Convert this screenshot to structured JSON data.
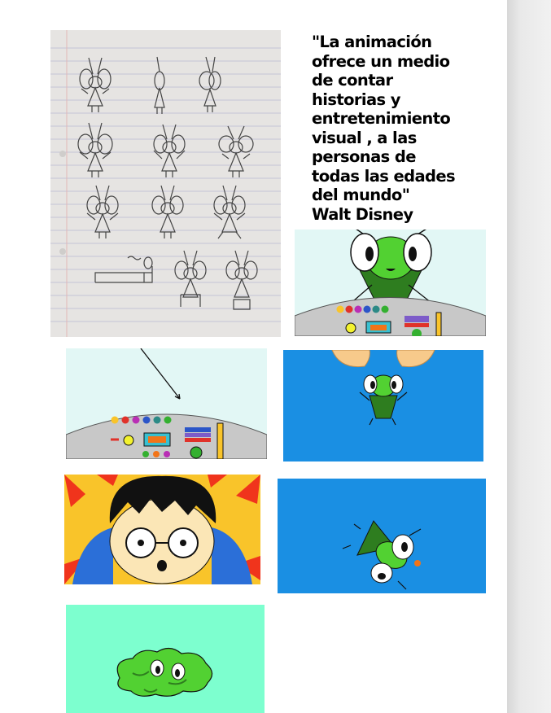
{
  "quote": {
    "lines": [
      "\"La animación",
      "ofrece un medio",
      "de contar",
      "historias y",
      "entretenimiento",
      "visual , a las",
      "personas de",
      "todas las edades",
      "del mundo\""
    ],
    "author": "Walt Disney"
  },
  "colors": {
    "sky_light": "#e2f7f5",
    "blue": "#1a8fe3",
    "mint": "#7dffcf",
    "alien_green": "#52d132",
    "alien_dark_green": "#2e7d1f",
    "yellow": "#f9c42a",
    "red": "#f0341c"
  },
  "panels": [
    {
      "name": "sketch-storyboard-photo",
      "icon": "pencil-sketch"
    },
    {
      "name": "alien-at-console-panel",
      "icon": "alien"
    },
    {
      "name": "console-only-panel",
      "icon": "control-panel"
    },
    {
      "name": "hands-grab-alien-panel",
      "icon": "hands"
    },
    {
      "name": "surprised-boy-panel",
      "icon": "boy-face"
    },
    {
      "name": "falling-alien-panel",
      "icon": "alien"
    },
    {
      "name": "melted-alien-panel",
      "icon": "alien-puddle"
    }
  ]
}
